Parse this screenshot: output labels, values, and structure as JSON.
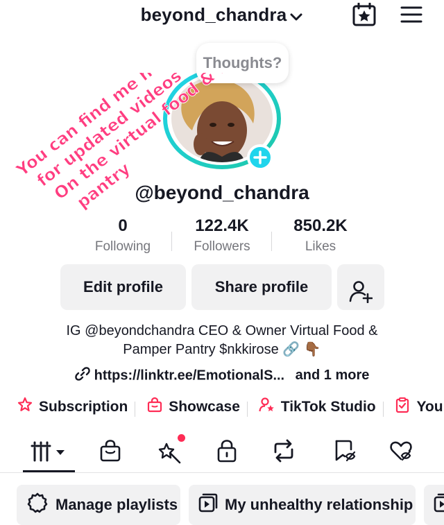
{
  "header": {
    "username": "beyond_chandra",
    "dropdown_icon": "chevron-down-icon",
    "calendar_icon": "calendar-star-icon",
    "menu_icon": "hamburger-menu-icon"
  },
  "profile": {
    "bubble_text": "Thoughts?",
    "handle": "@beyond_chandra",
    "overlay_text": [
      "You can find me here",
      "for updated videos",
      "On the virtual food & Pamper",
      "pantry"
    ],
    "overlay_color": "#ff3d80"
  },
  "stats": [
    {
      "value": "0",
      "label": "Following"
    },
    {
      "value": "122.4K",
      "label": "Followers"
    },
    {
      "value": "850.2K",
      "label": "Likes"
    }
  ],
  "actions": {
    "edit": "Edit profile",
    "share": "Share profile",
    "add_friend_icon": "add-person-icon"
  },
  "bio": {
    "line1": "IG @beyondchandra CEO & Owner Virtual Food &",
    "line2": "Pamper Pantry $nkkirose 🔗 👇🏾",
    "link": "https://linktr.ee/EmotionalS...",
    "more": "and 1 more"
  },
  "shortcuts": [
    {
      "label": "Subscription",
      "icon": "subscription-star-icon"
    },
    {
      "label": "Showcase",
      "icon": "shopping-bag-icon"
    },
    {
      "label": "TikTok Studio",
      "icon": "person-star-icon"
    },
    {
      "label": "You",
      "icon": "clipboard-check-icon"
    }
  ],
  "tabs": [
    {
      "name": "videos-grid",
      "icon": "grid-bars-icon"
    },
    {
      "name": "shop",
      "icon": "bag-icon"
    },
    {
      "name": "effects",
      "icon": "sparkle-wand-icon",
      "has_notification": true
    },
    {
      "name": "private",
      "icon": "lock-icon"
    },
    {
      "name": "reposts",
      "icon": "repost-icon"
    },
    {
      "name": "favorites",
      "icon": "bookmark-hidden-icon"
    },
    {
      "name": "liked",
      "icon": "heart-hidden-icon"
    }
  ],
  "playlists": {
    "manage": "Manage playlists",
    "playlist1": "My unhealthy relationship"
  },
  "colors": {
    "accent_pink": "#fe2c55",
    "teal": "#20d5ec",
    "text": "#161823",
    "muted": "#75767c",
    "button_bg": "#f1f1f2"
  }
}
